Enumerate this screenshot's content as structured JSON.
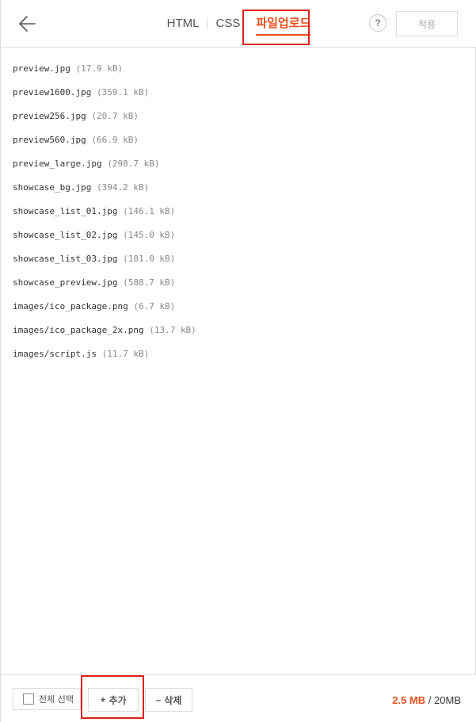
{
  "header": {
    "back_icon": "arrow-left-icon",
    "tabs": [
      {
        "label": "HTML",
        "active": false
      },
      {
        "label": "CSS",
        "active": false
      },
      {
        "label": "파일업로드",
        "active": true
      }
    ],
    "help_label": "?",
    "apply_label": "적용"
  },
  "files": [
    {
      "name": "preview.jpg",
      "size": "(17.9 kB)"
    },
    {
      "name": "preview1600.jpg",
      "size": "(359.1 kB)"
    },
    {
      "name": "preview256.jpg",
      "size": "(20.7 kB)"
    },
    {
      "name": "preview560.jpg",
      "size": "(66.9 kB)"
    },
    {
      "name": "preview_large.jpg",
      "size": "(298.7 kB)"
    },
    {
      "name": "showcase_bg.jpg",
      "size": "(394.2 kB)"
    },
    {
      "name": "showcase_list_01.jpg",
      "size": "(146.1 kB)"
    },
    {
      "name": "showcase_list_02.jpg",
      "size": "(145.0 kB)"
    },
    {
      "name": "showcase_list_03.jpg",
      "size": "(181.0 kB)"
    },
    {
      "name": "showcase_preview.jpg",
      "size": "(588.7 kB)"
    },
    {
      "name": "images/ico_package.png",
      "size": "(6.7 kB)"
    },
    {
      "name": "images/ico_package_2x.png",
      "size": "(13.7 kB)"
    },
    {
      "name": "images/script.js",
      "size": "(11.7 kB)"
    }
  ],
  "footer": {
    "select_all_label": "전체 선택",
    "add_symbol": "+",
    "add_label": "추가",
    "delete_symbol": "–",
    "delete_label": "삭제",
    "used": "2.5 MB",
    "limit": " / 20MB"
  },
  "colors": {
    "accent": "#e8501e",
    "highlight": "#e0201a"
  }
}
